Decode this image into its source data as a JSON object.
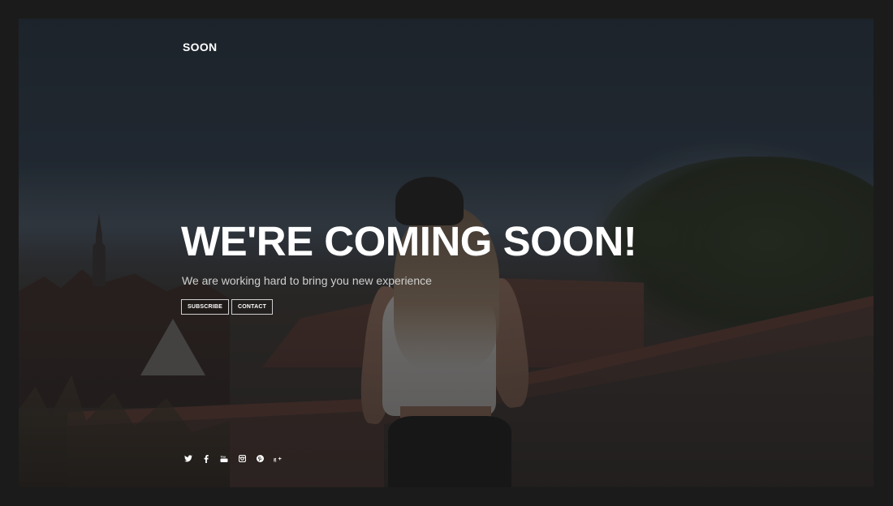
{
  "brand": {
    "name": "SOON"
  },
  "hero": {
    "headline": "WE'RE COMING SOON!",
    "subtitle": "We are working hard to bring you new experience"
  },
  "buttons": {
    "subscribe": "SUBSCRIBE",
    "contact": "CONTACT"
  },
  "social": [
    "twitter-icon",
    "facebook-icon",
    "youtube-icon",
    "instagram-icon",
    "pinterest-icon",
    "google-plus-icon"
  ],
  "colors": {
    "page_border": "#1b1b1b",
    "text": "#ffffff",
    "subtitle": "#cfcfcf"
  }
}
